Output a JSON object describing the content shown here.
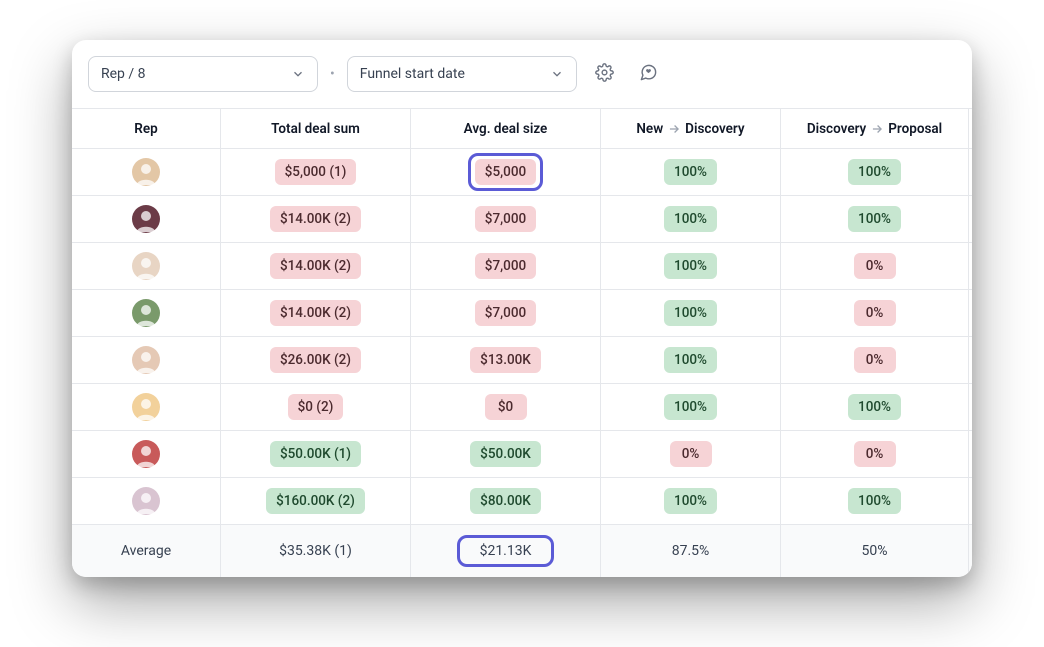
{
  "toolbar": {
    "rep_select_label": "Rep / 8",
    "date_select_label": "Funnel start date"
  },
  "headers": {
    "rep": "Rep",
    "total": "Total deal sum",
    "avg": "Avg. deal size",
    "stage1_from": "New",
    "stage1_to": "Discovery",
    "stage2_from": "Discovery",
    "stage2_to": "Proposal"
  },
  "rows": [
    {
      "avatar_bg": "#e3c7a6",
      "total": {
        "text": "$5,000 (1)",
        "tone": "pink"
      },
      "avg": {
        "text": "$5,000",
        "tone": "pink",
        "highlight": true
      },
      "s1": {
        "text": "100%",
        "tone": "green"
      },
      "s2": {
        "text": "100%",
        "tone": "green"
      }
    },
    {
      "avatar_bg": "#6b3b47",
      "total": {
        "text": "$14.00K (2)",
        "tone": "pink"
      },
      "avg": {
        "text": "$7,000",
        "tone": "pink"
      },
      "s1": {
        "text": "100%",
        "tone": "green"
      },
      "s2": {
        "text": "100%",
        "tone": "green"
      }
    },
    {
      "avatar_bg": "#e8d5c4",
      "total": {
        "text": "$14.00K (2)",
        "tone": "pink"
      },
      "avg": {
        "text": "$7,000",
        "tone": "pink"
      },
      "s1": {
        "text": "100%",
        "tone": "green"
      },
      "s2": {
        "text": "0%",
        "tone": "pink"
      }
    },
    {
      "avatar_bg": "#7a9a6b",
      "total": {
        "text": "$14.00K (2)",
        "tone": "pink"
      },
      "avg": {
        "text": "$7,000",
        "tone": "pink"
      },
      "s1": {
        "text": "100%",
        "tone": "green"
      },
      "s2": {
        "text": "0%",
        "tone": "pink"
      }
    },
    {
      "avatar_bg": "#e5c9b5",
      "total": {
        "text": "$26.00K (2)",
        "tone": "pink"
      },
      "avg": {
        "text": "$13.00K",
        "tone": "pink"
      },
      "s1": {
        "text": "100%",
        "tone": "green"
      },
      "s2": {
        "text": "0%",
        "tone": "pink"
      }
    },
    {
      "avatar_bg": "#f2d19b",
      "total": {
        "text": "$0 (2)",
        "tone": "pink"
      },
      "avg": {
        "text": "$0",
        "tone": "pink"
      },
      "s1": {
        "text": "100%",
        "tone": "green"
      },
      "s2": {
        "text": "100%",
        "tone": "green"
      }
    },
    {
      "avatar_bg": "#c85a5a",
      "total": {
        "text": "$50.00K (1)",
        "tone": "green"
      },
      "avg": {
        "text": "$50.00K",
        "tone": "green"
      },
      "s1": {
        "text": "0%",
        "tone": "pink"
      },
      "s2": {
        "text": "0%",
        "tone": "pink"
      }
    },
    {
      "avatar_bg": "#d9c4d1",
      "total": {
        "text": "$160.00K (2)",
        "tone": "green"
      },
      "avg": {
        "text": "$80.00K",
        "tone": "green"
      },
      "s1": {
        "text": "100%",
        "tone": "green"
      },
      "s2": {
        "text": "100%",
        "tone": "green"
      }
    }
  ],
  "footer": {
    "label": "Average",
    "total": "$35.38K (1)",
    "avg": "$21.13K",
    "s1": "87.5%",
    "s2": "50%"
  }
}
